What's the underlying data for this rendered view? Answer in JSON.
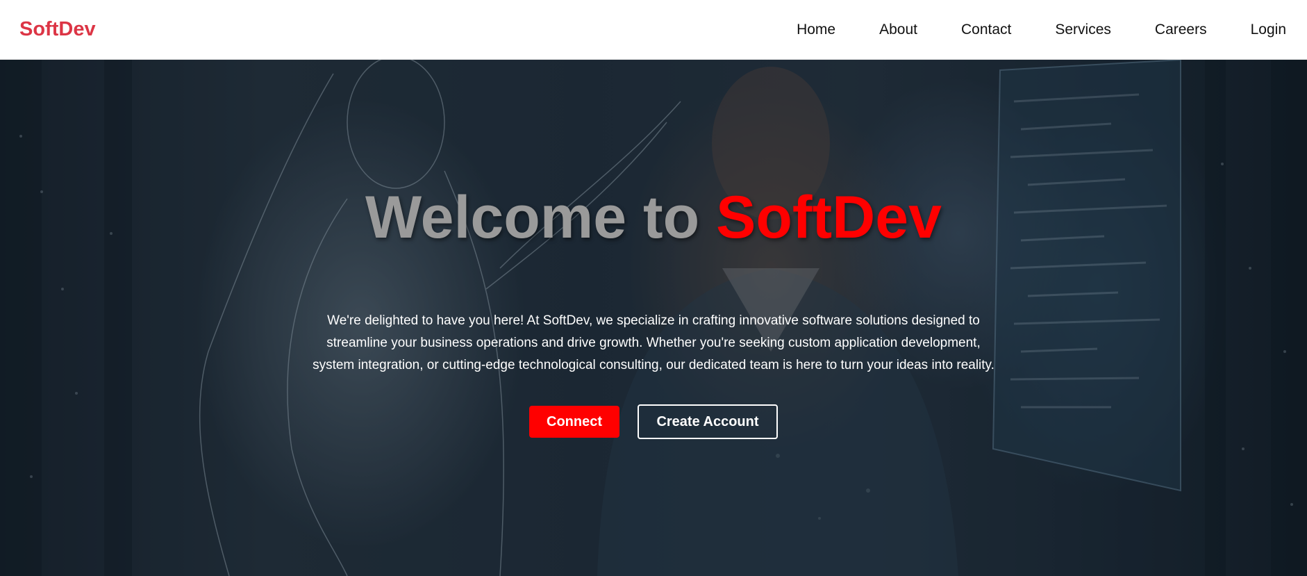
{
  "navbar": {
    "brand": "SoftDev",
    "links": [
      {
        "label": "Home"
      },
      {
        "label": "About"
      },
      {
        "label": "Contact"
      },
      {
        "label": "Services"
      },
      {
        "label": "Careers"
      },
      {
        "label": "Login"
      }
    ]
  },
  "hero": {
    "title_part1": "Welcome to",
    "title_part2": "SoftDev",
    "description": "We're delighted to have you here! At SoftDev, we specialize in crafting innovative software solutions designed to streamline your business operations and drive growth. Whether you're seeking custom application development, system integration, or cutting-edge technological consulting, our dedicated team is here to turn your ideas into reality.",
    "buttons": {
      "connect_label": "Connect",
      "create_account_label": "Create Account"
    }
  },
  "colors": {
    "brand_red": "#dc3545",
    "accent_red": "#ff0000",
    "title_gray": "#9a9a9a",
    "nav_text": "#111111",
    "hero_text": "#ffffff"
  }
}
